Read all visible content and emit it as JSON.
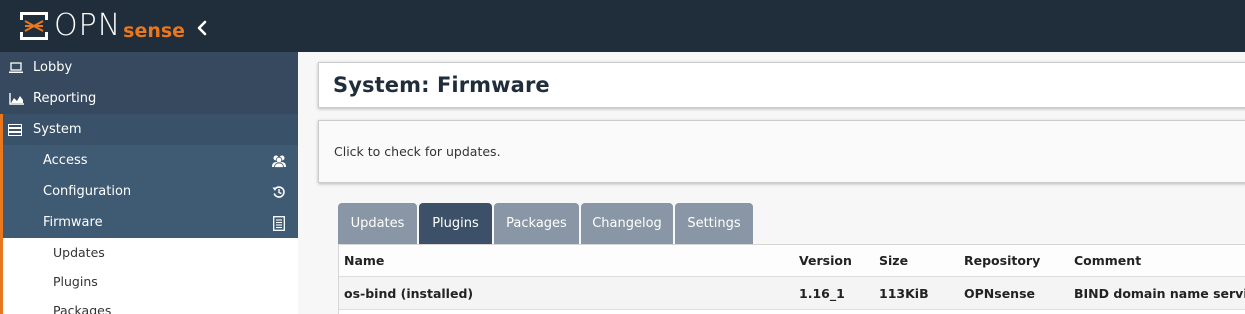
{
  "header": {
    "logo_text_main": "OPN",
    "logo_text_accent": "sense",
    "collapse_icon": "chevron-left-icon",
    "colors": {
      "bar": "#202d3b",
      "accent": "#e8771e"
    }
  },
  "sidebar": {
    "top_items": [
      {
        "label": "Lobby",
        "icon": "laptop-icon"
      },
      {
        "label": "Reporting",
        "icon": "area-chart-icon"
      }
    ],
    "system": {
      "label": "System",
      "icon": "server-icon"
    },
    "sub_items": [
      {
        "label": "Access",
        "icon": "users-icon"
      },
      {
        "label": "Configuration",
        "icon": "history-icon"
      },
      {
        "label": "Firmware",
        "icon": "file-text-icon"
      }
    ],
    "leaf_items": [
      {
        "label": "Updates"
      },
      {
        "label": "Plugins"
      },
      {
        "label": "Packages"
      }
    ]
  },
  "page": {
    "title": "System: Firmware",
    "info_text": "Click to check for updates."
  },
  "tabs": [
    {
      "label": "Updates",
      "active": false
    },
    {
      "label": "Plugins",
      "active": true
    },
    {
      "label": "Packages",
      "active": false
    },
    {
      "label": "Changelog",
      "active": false
    },
    {
      "label": "Settings",
      "active": false
    }
  ],
  "table": {
    "columns": [
      "Name",
      "Version",
      "Size",
      "Repository",
      "Comment"
    ],
    "rows": [
      {
        "name": "os-bind (installed)",
        "version": "1.16_1",
        "size": "113KiB",
        "repository": "OPNsense",
        "comment": "BIND domain name service"
      }
    ]
  }
}
